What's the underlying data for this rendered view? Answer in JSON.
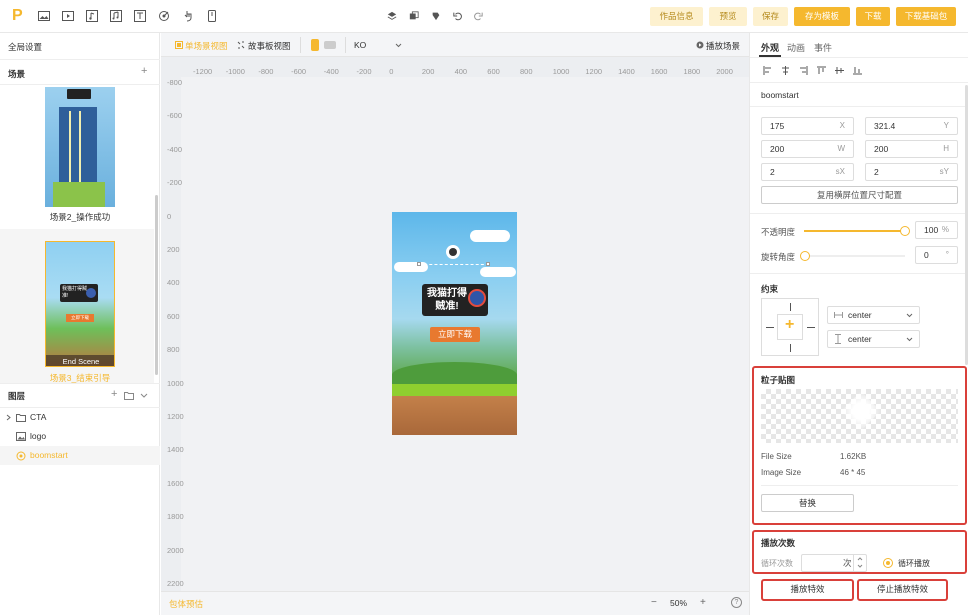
{
  "topbar": {
    "logo": "P",
    "buttons": {
      "info": "作品信息",
      "preview": "预览",
      "save": "保存",
      "save_template": "存为模板",
      "download": "下载",
      "download_pkg": "下载基础包"
    }
  },
  "left": {
    "global_settings": "全局设置",
    "scenes_title": "场景",
    "scene2_label": "场景2_操作成功",
    "scene3_label": "场景3_结束引导",
    "end_scene": "End Scene",
    "thumb_text": "我猫打得贼准!",
    "thumb_btn": "立即下载",
    "layers_title": "图层",
    "layers": [
      {
        "name": "CTA"
      },
      {
        "name": "logo"
      },
      {
        "name": "boomstart"
      }
    ]
  },
  "canvas": {
    "view_single": "单场景视图",
    "view_story": "故事板视图",
    "lang": "KO",
    "play_scene": "播放场景",
    "ruler_x": [
      "-1200",
      "-1000",
      "-800",
      "-600",
      "-400",
      "-200",
      "0",
      "200",
      "400",
      "600",
      "800",
      "1000",
      "1200",
      "1400",
      "1600",
      "1800",
      "2000"
    ],
    "ruler_y": [
      "-800",
      "-600",
      "-400",
      "-200",
      "0",
      "200",
      "400",
      "600",
      "800",
      "1000",
      "1200",
      "1400",
      "1600",
      "1800",
      "2000",
      "2200"
    ],
    "phone_text_l1": "我猫打得",
    "phone_text_l2": "贼准!",
    "phone_btn": "立即下载",
    "bottom_label": "包体预估",
    "zoom": "50%",
    "zoom_minus": "−",
    "zoom_plus": "+",
    "help": "?"
  },
  "right": {
    "tabs": [
      "外观",
      "动画",
      "事件"
    ],
    "element_name": "boomstart",
    "x": "175",
    "x_unit": "X",
    "y": "321.4",
    "y_unit": "Y",
    "w": "200",
    "w_unit": "W",
    "h": "200",
    "h_unit": "H",
    "sx": "2",
    "sx_unit": "sX",
    "sy": "2",
    "sy_unit": "sY",
    "reuse_btn": "复用横屏位置尺寸配置",
    "opacity_label": "不透明度",
    "opacity_value": "100",
    "opacity_unit": "%",
    "opacity_fraction": 1.0,
    "rotation_label": "旋转角度",
    "rotation_value": "0",
    "rotation_unit": "°",
    "constraint_title": "约束",
    "constraint_h": "center",
    "constraint_v": "center",
    "particle_title": "粒子贴图",
    "file_size_label": "File Size",
    "file_size": "1.62KB",
    "image_size_label": "Image Size",
    "image_size": "46 * 45",
    "replace_btn": "替换",
    "play_count_title": "播放次数",
    "loop_count_label": "循环次数",
    "loop_unit": "次",
    "loop_play": "循环播放",
    "play_fx": "播放特效",
    "stop_fx": "停止播放特效"
  },
  "colors": {
    "accent": "#f5b82e",
    "red": "#d9403a"
  }
}
